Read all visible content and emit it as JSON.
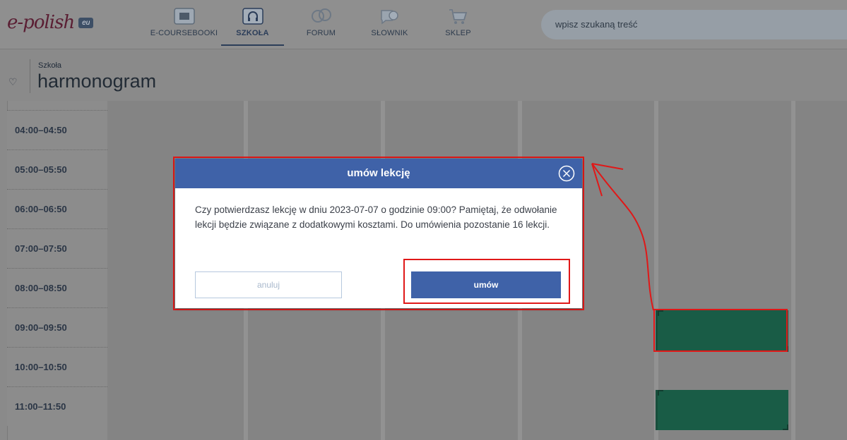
{
  "logo": {
    "text": "e-polish",
    "badge": "eu"
  },
  "nav": {
    "items": [
      {
        "label": "E-COURSEBOOKI",
        "icon": "book-icon",
        "active": false
      },
      {
        "label": "SZKOŁA",
        "icon": "headphones-icon",
        "active": true
      },
      {
        "label": "FORUM",
        "icon": "forum-icon",
        "active": false
      },
      {
        "label": "SŁOWNIK",
        "icon": "dictionary-icon",
        "active": false
      },
      {
        "label": "SKLEP",
        "icon": "cart-icon",
        "active": false
      }
    ]
  },
  "search": {
    "placeholder": "wpisz szukaną treść"
  },
  "breadcrumb": "Szkoła",
  "page_title": "harmonogram",
  "schedule": {
    "times": [
      "04:00–04:50",
      "05:00–05:50",
      "06:00–06:50",
      "07:00–07:50",
      "08:00–08:50",
      "09:00–09:50",
      "10:00–10:50",
      "11:00–11:50"
    ]
  },
  "modal": {
    "title": "umów lekcję",
    "message": "Czy potwierdzasz lekcję w dniu 2023-07-07 o godzinie 09:00? Pamiętaj, że odwołanie lekcji będzie związane z dodatkowymi kosztami. Do umówienia pozostanie 16 lekcji.",
    "cancel_label": "anuluj",
    "confirm_label": "umów"
  },
  "colors": {
    "header_blue": "#3f62a8",
    "slot_green": "#195c46",
    "annotation_red": "#e01818"
  }
}
